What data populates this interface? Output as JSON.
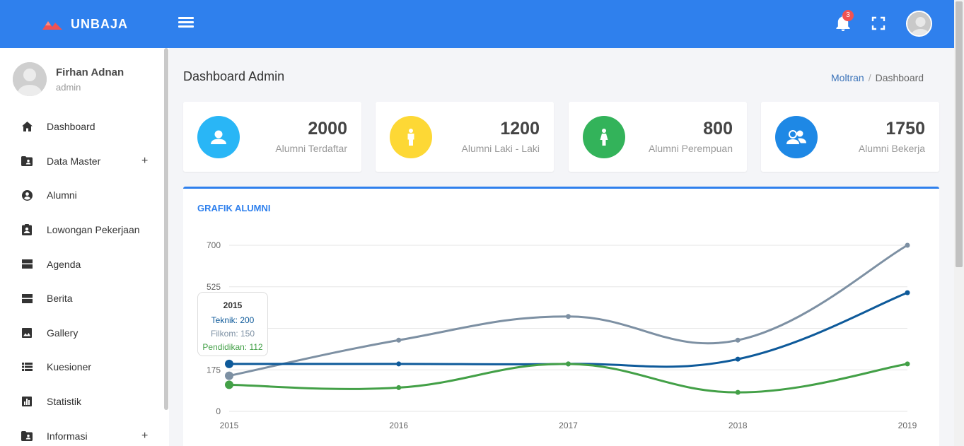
{
  "brand": {
    "name": "UNBAJA",
    "color": "#2f80ed",
    "logo_color": "#f05252"
  },
  "header": {
    "notification_count": "3",
    "icons": [
      "menu-icon",
      "bell-icon",
      "fullscreen-icon",
      "avatar"
    ]
  },
  "user": {
    "name": "Firhan Adnan",
    "role": "admin"
  },
  "sidebar": {
    "items": [
      {
        "label": "Dashboard",
        "icon": "home-icon",
        "has_submenu": false
      },
      {
        "label": "Data Master",
        "icon": "folder-user-icon",
        "has_submenu": true,
        "expand": "+"
      },
      {
        "label": "Alumni",
        "icon": "user-circle-icon",
        "has_submenu": false
      },
      {
        "label": "Lowongan Pekerjaan",
        "icon": "clipboard-user-icon",
        "has_submenu": false
      },
      {
        "label": "Agenda",
        "icon": "dns-icon",
        "has_submenu": false
      },
      {
        "label": "Berita",
        "icon": "dns-icon",
        "has_submenu": false
      },
      {
        "label": "Gallery",
        "icon": "image-icon",
        "has_submenu": false
      },
      {
        "label": "Kuesioner",
        "icon": "list-icon",
        "has_submenu": false
      },
      {
        "label": "Statistik",
        "icon": "bar-chart-icon",
        "has_submenu": false
      },
      {
        "label": "Informasi",
        "icon": "folder-user-icon",
        "has_submenu": true,
        "expand": "+"
      }
    ]
  },
  "page": {
    "title": "Dashboard Admin",
    "breadcrumb": {
      "link": "Moltran",
      "separator": "/",
      "current": "Dashboard"
    }
  },
  "stats": [
    {
      "value": "2000",
      "label": "Alumni Terdaftar",
      "color": "#29b6f6",
      "icon": "user-icon"
    },
    {
      "value": "1200",
      "label": "Alumni Laki - Laki",
      "color": "#fdd835",
      "icon": "male-icon"
    },
    {
      "value": "800",
      "label": "Alumni Perempuan",
      "color": "#33b35a",
      "icon": "female-icon"
    },
    {
      "value": "1750",
      "label": "Alumni Bekerja",
      "color": "#1e88e5",
      "icon": "users-icon"
    }
  ],
  "chart_title": "GRAFIK ALUMNI",
  "tooltip": {
    "title": "2015",
    "lines": [
      "Teknik: 200",
      "Filkom: 150",
      "Pendidikan: 112"
    ]
  },
  "chart_data": {
    "type": "line",
    "title": "GRAFIK ALUMNI",
    "x": [
      "2015",
      "2016",
      "2017",
      "2018",
      "2019"
    ],
    "ylim": [
      0,
      700
    ],
    "yticks": [
      0,
      175,
      525,
      700
    ],
    "grid": true,
    "series": [
      {
        "name": "Teknik",
        "color": "#0e5a9a",
        "values": [
          200,
          200,
          200,
          220,
          500
        ]
      },
      {
        "name": "Filkom",
        "color": "#7d90a3",
        "values": [
          150,
          300,
          400,
          300,
          700
        ]
      },
      {
        "name": "Pendidikan",
        "color": "#43a047",
        "values": [
          112,
          100,
          200,
          80,
          200
        ]
      }
    ]
  }
}
